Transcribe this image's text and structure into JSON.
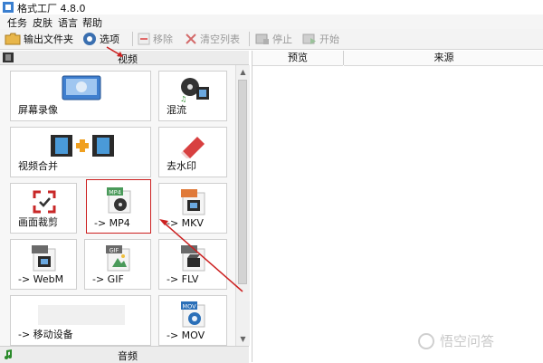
{
  "window": {
    "title": "格式工厂 4.8.0"
  },
  "menu": [
    "任务",
    "皮肤",
    "语言",
    "帮助"
  ],
  "toolbar": {
    "output_folder": "输出文件夹",
    "options": "选项",
    "remove": "移除",
    "clear_list": "清空列表",
    "stop": "停止",
    "start": "开始"
  },
  "left_panel": {
    "video_header": "视频",
    "audio_footer": "音频"
  },
  "tiles": [
    {
      "label": "屏幕录像",
      "icon": "screen-record-icon"
    },
    {
      "label": "混流",
      "icon": "mux-icon"
    },
    {
      "label": "视频合并",
      "icon": "video-merge-icon"
    },
    {
      "label": "去水印",
      "icon": "remove-watermark-icon"
    },
    {
      "label": "画面裁剪",
      "icon": "crop-icon"
    },
    {
      "label": "-> MP4",
      "icon": "mp4-icon",
      "badge": "MP4"
    },
    {
      "label": "-> MKV",
      "icon": "mkv-icon"
    },
    {
      "label": "-> WebM",
      "icon": "webm-icon"
    },
    {
      "label": "-> GIF",
      "icon": "gif-icon",
      "badge": "GIF"
    },
    {
      "label": "-> FLV",
      "icon": "flv-icon"
    },
    {
      "label": "-> 移动设备",
      "icon": "mobile-device-icon"
    },
    {
      "label": "-> MOV",
      "icon": "mov-icon",
      "badge": "MOV"
    }
  ],
  "task_list": {
    "columns": [
      "预览",
      "来源"
    ]
  },
  "watermark": "悟空问答",
  "colors": {
    "highlight": "#cc2020",
    "accent_blue": "#2a6fb8"
  }
}
